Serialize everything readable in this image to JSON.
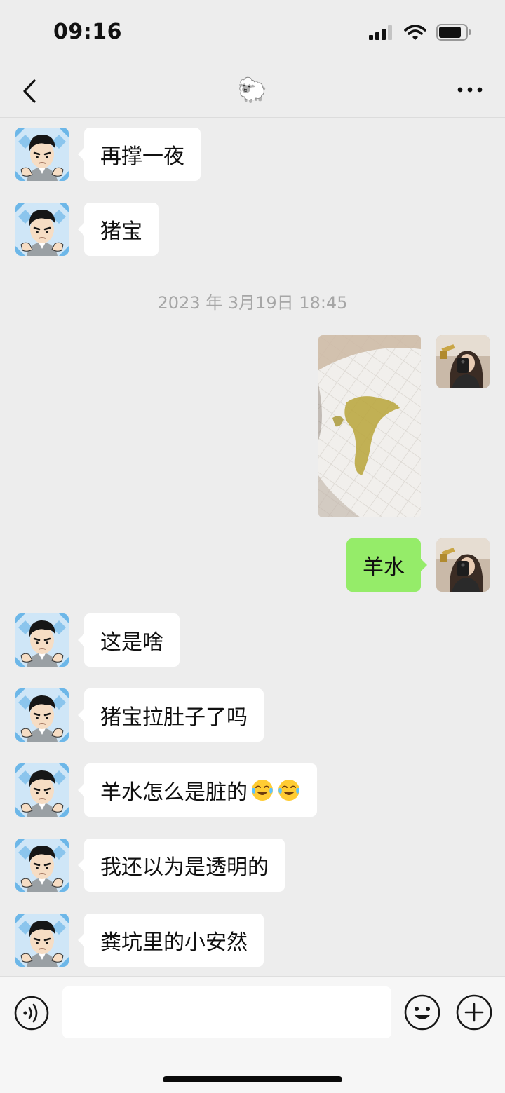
{
  "status_bar": {
    "time": "09:16"
  },
  "header": {
    "title": "🐑"
  },
  "messages": [
    {
      "side": "left",
      "text": "再撑一夜"
    },
    {
      "side": "left",
      "text": "猪宝"
    },
    {
      "type": "timestamp",
      "text": "2023 年 3月19日 18:45"
    },
    {
      "side": "right",
      "type": "image"
    },
    {
      "side": "right",
      "text": "羊水"
    },
    {
      "side": "left",
      "text": "这是啥"
    },
    {
      "side": "left",
      "text": "猪宝拉肚子了吗"
    },
    {
      "side": "left",
      "text": "羊水怎么是脏的",
      "emoji": "laughing-crying-emoji"
    },
    {
      "side": "left",
      "text": "我还以为是透明的"
    },
    {
      "side": "left",
      "text": "粪坑里的小安然"
    }
  ],
  "input": {
    "value": ""
  },
  "colors": {
    "background": "#ededed",
    "sent_bubble": "#95ec69",
    "received_bubble": "#ffffff"
  }
}
